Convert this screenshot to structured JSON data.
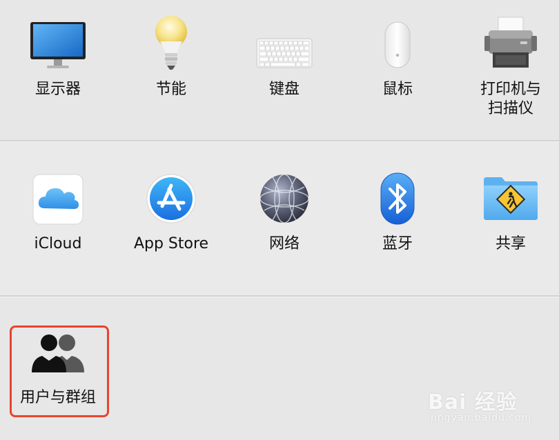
{
  "row1": [
    {
      "label": "显示器",
      "icon": "display-icon"
    },
    {
      "label": "节能",
      "icon": "lightbulb-icon"
    },
    {
      "label": "键盘",
      "icon": "keyboard-icon"
    },
    {
      "label": "鼠标",
      "icon": "mouse-icon"
    },
    {
      "label": "打印机与\n扫描仪",
      "icon": "printer-icon"
    }
  ],
  "row2": [
    {
      "label": "iCloud",
      "icon": "icloud-icon"
    },
    {
      "label": "App Store",
      "icon": "app-store-icon"
    },
    {
      "label": "网络",
      "icon": "network-globe-icon"
    },
    {
      "label": "蓝牙",
      "icon": "bluetooth-icon"
    },
    {
      "label": "共享",
      "icon": "sharing-folder-icon"
    }
  ],
  "row3": [
    {
      "label": "用户与群组",
      "icon": "users-groups-icon"
    }
  ],
  "colors": {
    "highlight": "#e8432f",
    "accent_blue": "#1f7ae0"
  },
  "watermark": {
    "brand": "Bai 经验",
    "url": "jingyan.baidu.com"
  }
}
